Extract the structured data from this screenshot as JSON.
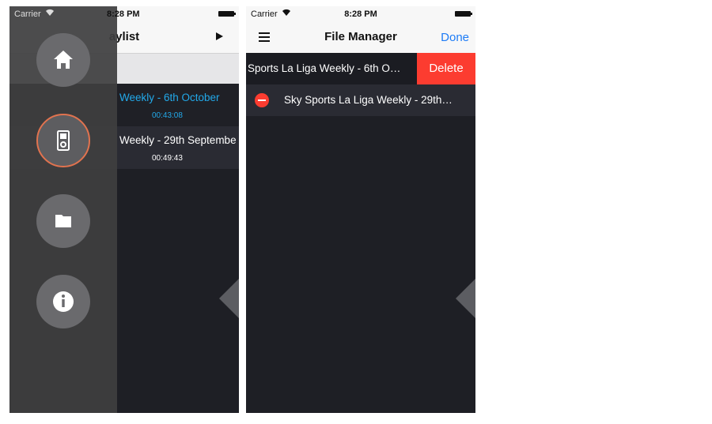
{
  "left_screen": {
    "status": {
      "carrier": "Carrier",
      "time": "8:28 PM"
    },
    "nav_title": "Playlist",
    "nav_title_visible": "aylist",
    "items": [
      {
        "title": "Weekly - 6th October",
        "duration": "00:43:08"
      },
      {
        "title": "Weekly - 29th Septembe",
        "duration": "00:49:43"
      }
    ],
    "drawer": [
      "home-icon",
      "ipod-icon",
      "folder-icon",
      "info-icon"
    ]
  },
  "right_screen": {
    "status": {
      "carrier": "Carrier",
      "time": "8:28 PM"
    },
    "title": "File Manager",
    "done_label": "Done",
    "rows": [
      {
        "title": "Sports La Liga Weekly - 6th O…",
        "action": "Delete"
      },
      {
        "title": "Sky Sports La Liga Weekly - 29th…"
      }
    ]
  },
  "colors": {
    "accent_blue": "#1e7cf6",
    "delete_red": "#fc3c30",
    "active_orange": "#e1734f",
    "highlight_blue": "#22a9ea"
  }
}
